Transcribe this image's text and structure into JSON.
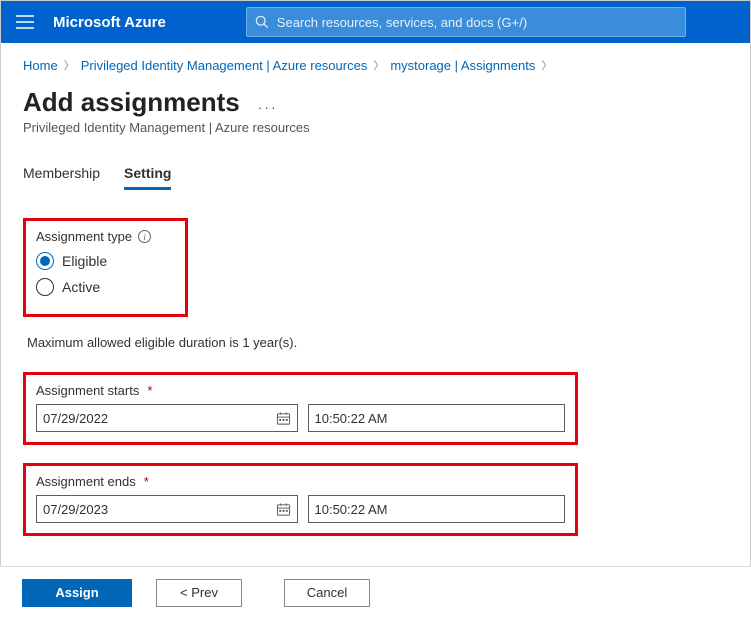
{
  "topbar": {
    "brand": "Microsoft Azure",
    "search_placeholder": "Search resources, services, and docs (G+/)"
  },
  "breadcrumb": {
    "items": [
      "Home",
      "Privileged Identity Management | Azure resources",
      "mystorage | Assignments"
    ]
  },
  "page": {
    "title": "Add assignments",
    "subtitle": "Privileged Identity Management | Azure resources"
  },
  "tabs": {
    "membership": "Membership",
    "setting": "Setting"
  },
  "assignment_type": {
    "label": "Assignment type",
    "eligible": "Eligible",
    "active": "Active"
  },
  "note": "Maximum allowed eligible duration is 1 year(s).",
  "starts": {
    "label": "Assignment starts",
    "date": "07/29/2022",
    "time": "10:50:22 AM"
  },
  "ends": {
    "label": "Assignment ends",
    "date": "07/29/2023",
    "time": "10:50:22 AM"
  },
  "footer": {
    "assign": "Assign",
    "prev": "<  Prev",
    "cancel": "Cancel"
  }
}
